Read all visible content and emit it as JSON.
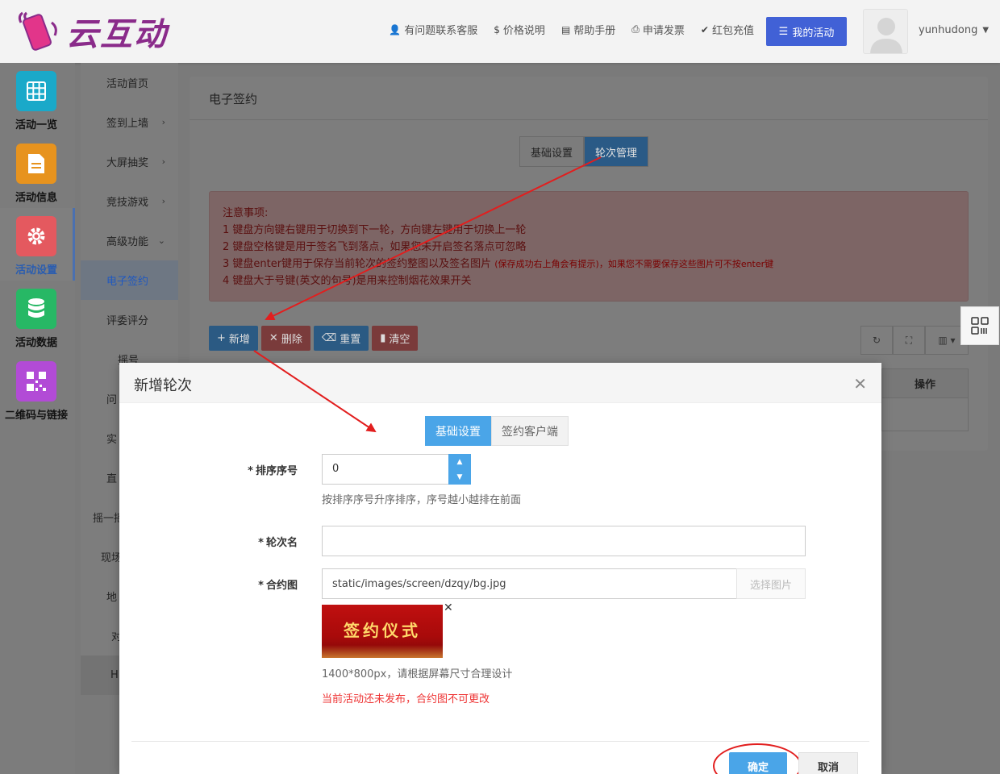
{
  "header": {
    "logo_text": "云互动",
    "links": [
      {
        "icon": "person-add-icon",
        "glyph": "👤",
        "label": "有问题联系客服"
      },
      {
        "icon": "dollar-icon",
        "glyph": "$",
        "label": "价格说明"
      },
      {
        "icon": "book-icon",
        "glyph": "▤",
        "label": "帮助手册"
      },
      {
        "icon": "printer-icon",
        "glyph": "⎙",
        "label": "申请发票"
      },
      {
        "icon": "shield-check-icon",
        "glyph": "✔",
        "label": "红包充值"
      }
    ],
    "my_activity": "我的活动",
    "username": "yunhudong"
  },
  "rail": [
    {
      "label": "活动一览",
      "color": "#1aa9c9",
      "icon": "grid-icon"
    },
    {
      "label": "活动信息",
      "color": "#e7931e",
      "icon": "document-icon"
    },
    {
      "label": "活动设置",
      "color": "#e4595f",
      "icon": "gear-icon"
    },
    {
      "label": "活动数据",
      "color": "#27b865",
      "icon": "database-icon"
    },
    {
      "label": "二维码与链接",
      "color": "#b24bd6",
      "icon": "qrcode-icon"
    }
  ],
  "submenu": [
    {
      "label": "活动首页",
      "chev": ""
    },
    {
      "label": "签到上墙",
      "chev": "›"
    },
    {
      "label": "大屏抽奖",
      "chev": "›"
    },
    {
      "label": "竞技游戏",
      "chev": "›"
    },
    {
      "label": "高级功能",
      "chev": "⌄"
    },
    {
      "label": "电子签约",
      "chev": ""
    },
    {
      "label": "评委评分",
      "chev": ""
    },
    {
      "label": "摇号",
      "chev": ""
    },
    {
      "label": "问",
      "chev": ""
    },
    {
      "label": "实",
      "chev": ""
    },
    {
      "label": "直",
      "chev": ""
    },
    {
      "label": "摇一摇",
      "chev": ""
    },
    {
      "label": "现场",
      "chev": ""
    },
    {
      "label": "地",
      "chev": ""
    },
    {
      "label": "对",
      "chev": ""
    },
    {
      "label": "H",
      "chev": ""
    }
  ],
  "panel": {
    "title": "电子签约",
    "tabs": [
      "基础设置",
      "轮次管理"
    ],
    "notice_title": "注意事项:",
    "notice_lines": [
      "1 键盘方向键右键用于切换到下一轮，方向键左键用于切换上一轮",
      "2 键盘空格键是用于签名飞到落点，如果您未开启签名落点可忽略",
      "3 键盘enter键用于保存当前轮次的签约整图以及签名图片",
      "4 键盘大于号键(英文的句号)是用来控制烟花效果开关"
    ],
    "notice_small": "(保存成功右上角会有提示)，如果您不需要保存这些图片可不按enter键",
    "buttons": {
      "add": "新增",
      "delete": "删除",
      "reset": "重置",
      "clear": "清空"
    },
    "table_header": "操作"
  },
  "modal": {
    "title": "新增轮次",
    "tabs": [
      "基础设置",
      "签约客户端"
    ],
    "sort_label": "排序序号",
    "sort_value": "0",
    "sort_hint": "按排序序号升序排序，序号越小越排在前面",
    "round_label": "轮次名",
    "round_value": "",
    "image_label": "合约图",
    "image_path": "static/images/screen/dzqy/bg.jpg",
    "pick_image": "选择图片",
    "thumb_text": "签约仪式",
    "size_hint": "1400*800px，请根据屏幕尺寸合理设计",
    "warn_hint": "当前活动还未发布，合约图不可更改",
    "ok": "确定",
    "cancel": "取消"
  }
}
